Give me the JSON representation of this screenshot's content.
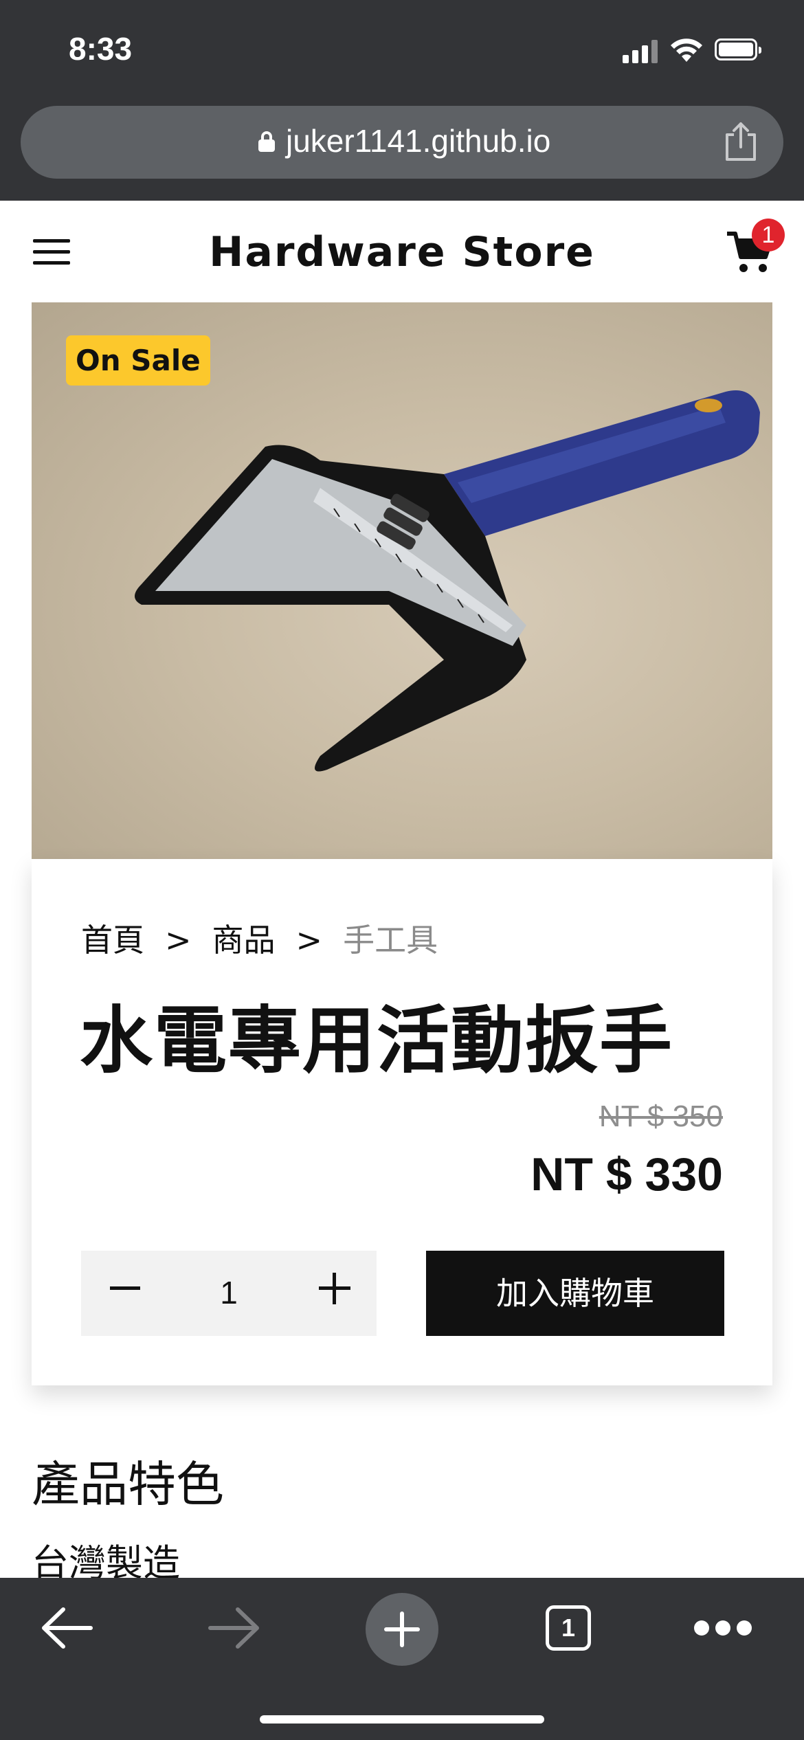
{
  "status_bar": {
    "time": "8:33"
  },
  "browser": {
    "url": "juker1141.github.io",
    "tab_count": "1"
  },
  "header": {
    "brand": "Hardware Store",
    "cart_count": "1"
  },
  "product": {
    "badge": "On Sale",
    "breadcrumb": [
      "首頁",
      "商品",
      "手工具"
    ],
    "breadcrumb_separator": ">",
    "title": "水電專用活動扳手",
    "price_original": "NT $ 350",
    "price_sale": "NT $ 330",
    "quantity": "1",
    "add_to_cart_label": "加入購物車"
  },
  "features": {
    "title": "產品特色",
    "items": [
      "台灣製造"
    ]
  },
  "colors": {
    "chrome": "#333437",
    "sale_badge": "#fcc82c",
    "cart_badge": "#e0242d",
    "wrench_handle": "#2e3a8c"
  },
  "icons": [
    "menu-icon",
    "cart-icon",
    "lock-icon",
    "share-icon",
    "back-arrow-icon",
    "forward-arrow-icon",
    "plus-icon",
    "tabs-icon",
    "more-icon"
  ]
}
